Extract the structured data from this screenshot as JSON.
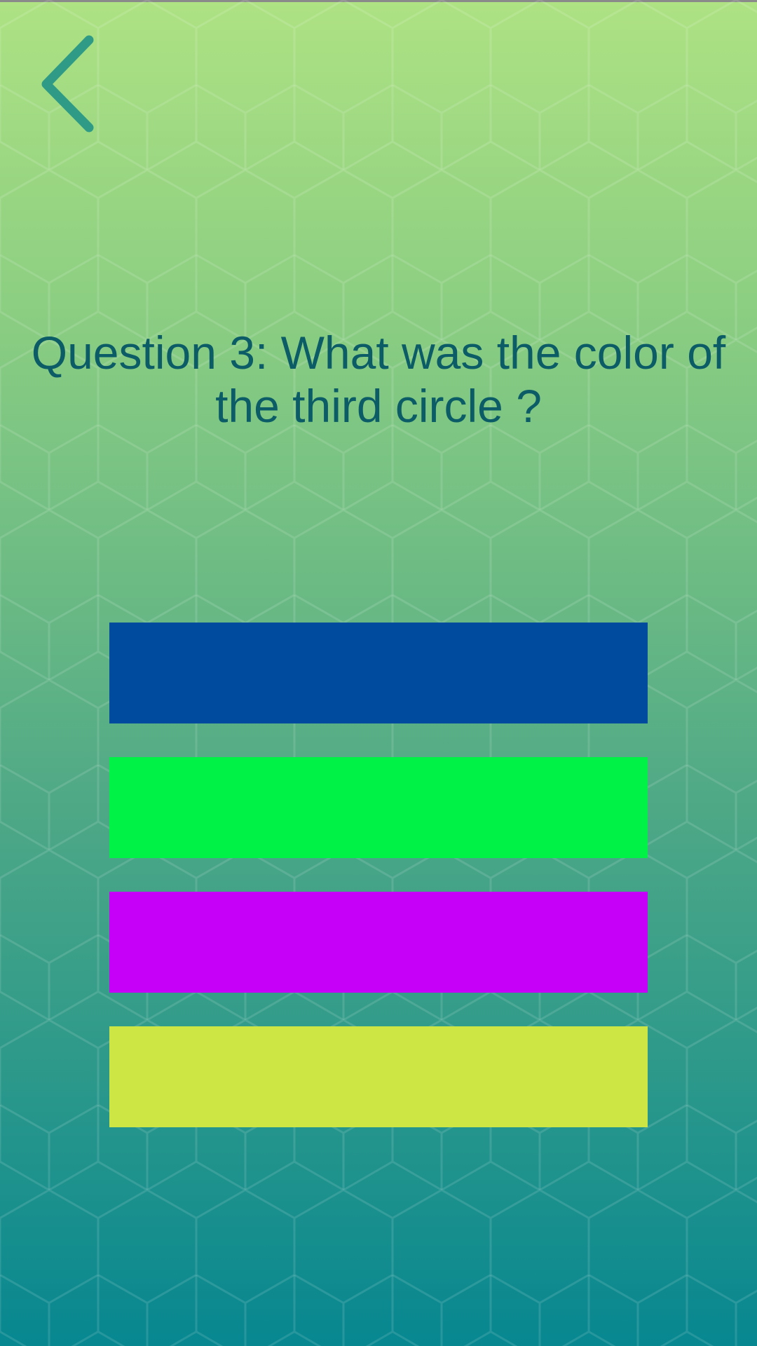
{
  "question": {
    "text": "Question 3: What was the color of the third circle ?"
  },
  "back_button": {
    "icon": "chevron-left-icon",
    "color": "#2f9b86"
  },
  "options": [
    {
      "color": "#004b9e"
    },
    {
      "color": "#00f246"
    },
    {
      "color": "#c600f8"
    },
    {
      "color": "#cde643"
    }
  ],
  "theme": {
    "text_color": "#0b5c66",
    "background_top": "#aee283",
    "background_bottom": "#078790"
  }
}
